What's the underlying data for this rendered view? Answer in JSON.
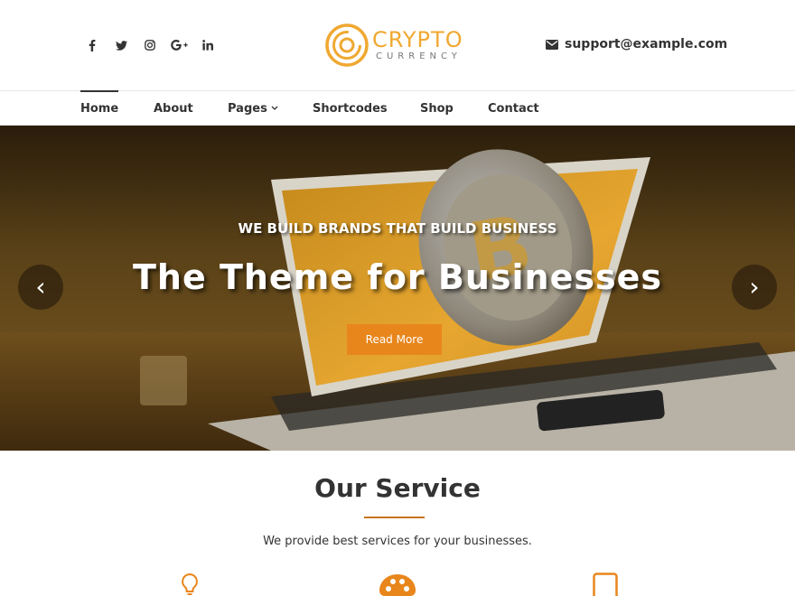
{
  "header": {
    "socials": [
      {
        "icon": "facebook-icon"
      },
      {
        "icon": "twitter-icon"
      },
      {
        "icon": "instagram-icon"
      },
      {
        "icon": "google-plus-icon"
      },
      {
        "icon": "linkedin-icon"
      }
    ],
    "logo": {
      "title": "CRYPTO",
      "subtitle": "CURRENCY"
    },
    "support_email": "support@example.com"
  },
  "nav": {
    "items": [
      {
        "label": "Home",
        "active": true
      },
      {
        "label": "About"
      },
      {
        "label": "Pages",
        "has_dropdown": true
      },
      {
        "label": "Shortcodes"
      },
      {
        "label": "Shop"
      },
      {
        "label": "Contact"
      }
    ]
  },
  "hero": {
    "subtitle": "WE BUILD BRANDS THAT BUILD BUSINESS",
    "title": "The Theme for Businesses",
    "button_label": "Read More",
    "prev_glyph": "‹",
    "next_glyph": "›"
  },
  "services": {
    "title": "Our Service",
    "description": "We provide best services for your businesses.",
    "icons": [
      "lightbulb-icon",
      "palette-icon",
      "mobile-icon"
    ]
  },
  "colors": {
    "accent": "#e8861c",
    "logo": "#f0a830",
    "text": "#333333"
  }
}
